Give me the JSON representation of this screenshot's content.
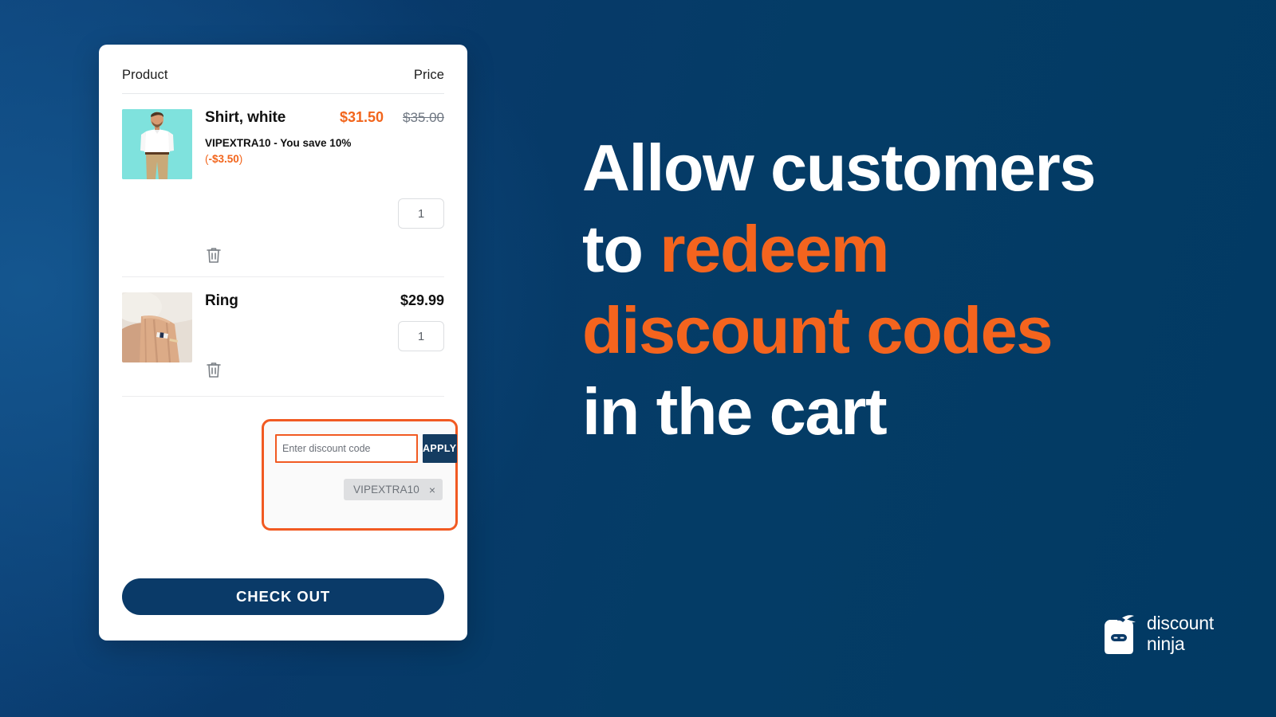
{
  "background": {
    "gradient_from": "#0d4279",
    "gradient_to": "#023a63"
  },
  "cart": {
    "header": {
      "product_label": "Product",
      "price_label": "Price"
    },
    "items": [
      {
        "name": "Shirt, white",
        "image_alt": "man-in-white-shirt-photo",
        "sale_price": "$31.50",
        "compare_price": "$35.00",
        "discount_text": "VIPEXTRA10 - You save 10%",
        "discount_amount_open": "(",
        "discount_amount": "-$3.50",
        "discount_amount_close": ")",
        "quantity": "1",
        "remove_icon": "trash-icon"
      },
      {
        "name": "Ring",
        "image_alt": "hand-with-ring-photo",
        "sale_price": "$29.99",
        "quantity": "1",
        "remove_icon": "trash-icon"
      }
    ],
    "discount_section": {
      "input_placeholder": "Enter discount code",
      "input_value": "",
      "apply_label": "APPLY",
      "applied_codes": [
        {
          "label": "VIPEXTRA10",
          "remove_glyph": "×"
        }
      ]
    },
    "checkout_label": "CHECK OUT"
  },
  "headline": {
    "line1": "Allow customers",
    "line2_prefix": "to ",
    "line2_accent": "redeem",
    "line3_accent": "discount codes",
    "line4": "in the cart",
    "accent_color": "#f4641e"
  },
  "logo": {
    "mark": "discount-ninja-tag-icon",
    "line1": "discount",
    "line2": "ninja"
  }
}
